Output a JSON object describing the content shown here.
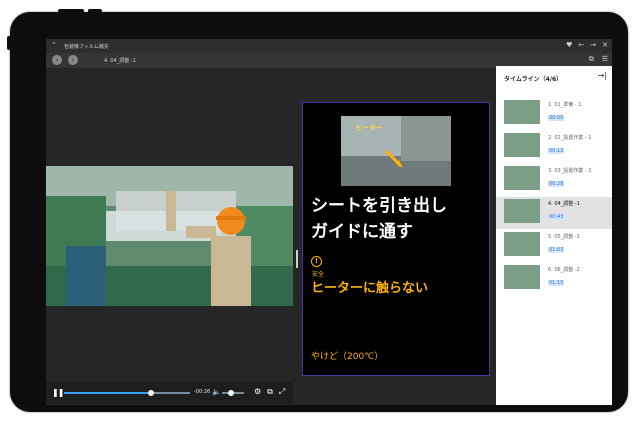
{
  "window": {
    "title": "包装機フィルム補充"
  },
  "toolbar": {
    "back_icon": "chevron-left",
    "forward_icon": "chevron-right",
    "breadcrumb": "4. 04_調整 -1"
  },
  "slide": {
    "callout_label": "ヒーター",
    "title_line1": "シートを引き出し",
    "title_line2": "ガイドに通す",
    "warning_icon": "!",
    "warning_category": "安全",
    "warning_text": "ヒーターに触らない",
    "note": "やけど（200℃）"
  },
  "player": {
    "time_remaining": "-00:26",
    "progress": 0.69,
    "volume": 0.4,
    "colors": {
      "progress": "#3aa0ff",
      "track": "#7a8ca5"
    }
  },
  "timeline": {
    "header": "タイムライン（4/6）",
    "items": [
      {
        "label": "1. 01_準備 - 1",
        "time": "00:00",
        "active": false
      },
      {
        "label": "2. 02_設置作業 - 1",
        "time": "00:12",
        "active": false
      },
      {
        "label": "3. 03_設置作業 - 2",
        "time": "00:28",
        "active": false
      },
      {
        "label": "4. 04_調整 -1",
        "time": "00:43",
        "active": true
      },
      {
        "label": "5. 05_調整 -1",
        "time": "01:03",
        "active": false
      },
      {
        "label": "6. 06_調整 -2",
        "time": "01:15",
        "active": false
      }
    ]
  }
}
